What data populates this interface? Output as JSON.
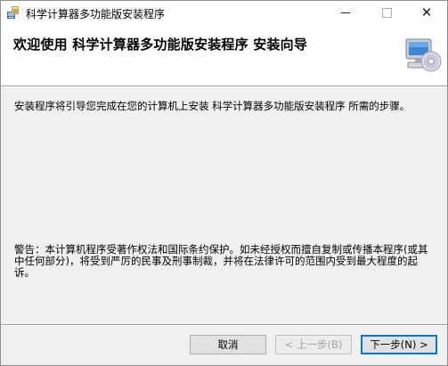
{
  "window": {
    "title": "科学计算器多功能版安装程序",
    "controls": {
      "minimize": "minimize",
      "maximize": "maximize",
      "close": "✕"
    }
  },
  "banner": {
    "title": "欢迎使用 科学计算器多功能版安装程序 安装向导"
  },
  "body": {
    "intro": "安装程序将引导您完成在您的计算机上安装 科学计算器多功能版安装程序 所需的步骤。",
    "warning": "警告：本计算机程序受著作权法和国际条约保护。如未经授权而擅自复制或传播本程序(或其中任何部分)，将受到严厉的民事及刑事制裁，并将在法律许可的范围内受到最大程度的起诉。"
  },
  "buttons": {
    "cancel": "取消",
    "back": "< 上一步(B)",
    "next": "下一步(N) >"
  },
  "icons": {
    "app": "installer-app-icon",
    "banner": "computer-cd-icon"
  }
}
